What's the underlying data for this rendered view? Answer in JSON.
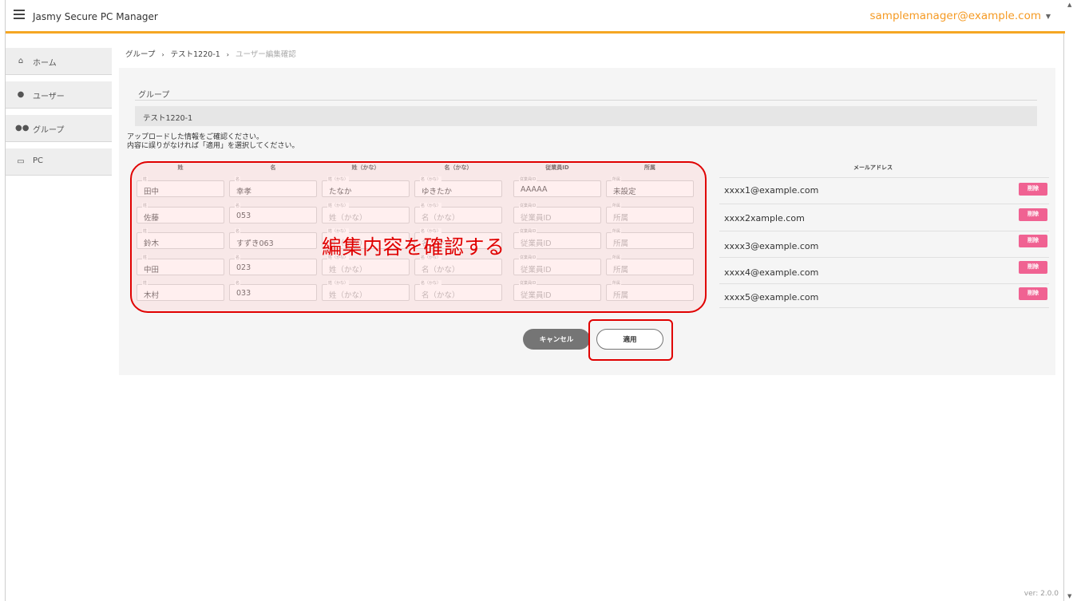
{
  "app": {
    "title": "Jasmy Secure PC Manager",
    "user_email": "samplemanager@example.com",
    "version": "ver: 2.0.0"
  },
  "sidebar": {
    "items": [
      {
        "label": "ホーム",
        "icon": "home-icon"
      },
      {
        "label": "ユーザー",
        "icon": "user-icon"
      },
      {
        "label": "グループ",
        "icon": "group-icon"
      },
      {
        "label": "PC",
        "icon": "monitor-icon"
      }
    ]
  },
  "breadcrumb": {
    "items": [
      "グループ",
      "テスト1220-1",
      "ユーザー編集確認"
    ]
  },
  "group": {
    "label": "グループ",
    "value": "テスト1220-1"
  },
  "instructions": {
    "line1": "アップロードした情報をご確認ください。",
    "line2": "内容に誤りがなければ「適用」を選択してください。"
  },
  "table": {
    "headers": [
      "姓",
      "名",
      "姓（かな）",
      "名（かな）",
      "従業員ID",
      "所属"
    ],
    "email_header": "メールアドレス",
    "field_labels": [
      "姓",
      "名",
      "姓（かな）",
      "名（かな）",
      "従業員ID",
      "所属"
    ],
    "placeholders": [
      "姓",
      "名",
      "姓（かな）",
      "名（かな）",
      "従業員ID",
      "所属"
    ],
    "rows": [
      {
        "cells": [
          "田中",
          "幸孝",
          "たなか",
          "ゆきたか",
          "AAAAA",
          "未設定"
        ],
        "email": "xxxx1@example.com"
      },
      {
        "cells": [
          "佐藤",
          "053",
          "",
          "",
          "",
          ""
        ],
        "email": "xxxx2xample.com"
      },
      {
        "cells": [
          "鈴木",
          "すずき063",
          "",
          "",
          "",
          ""
        ],
        "email": " xxxx3@example.com"
      },
      {
        "cells": [
          "中田",
          "023",
          "",
          "",
          "",
          ""
        ],
        "email": "xxxx4@example.com"
      },
      {
        "cells": [
          "木村",
          "033",
          "",
          "",
          "",
          ""
        ],
        "email": "xxxx5@example.com"
      }
    ],
    "delete_label": "削除"
  },
  "overlay_text": "編集内容を確認する",
  "buttons": {
    "cancel": "キャンセル",
    "apply": "適用"
  },
  "colors": {
    "accent": "#f5a623",
    "delete": "#f06292",
    "annotation": "#e00000"
  }
}
